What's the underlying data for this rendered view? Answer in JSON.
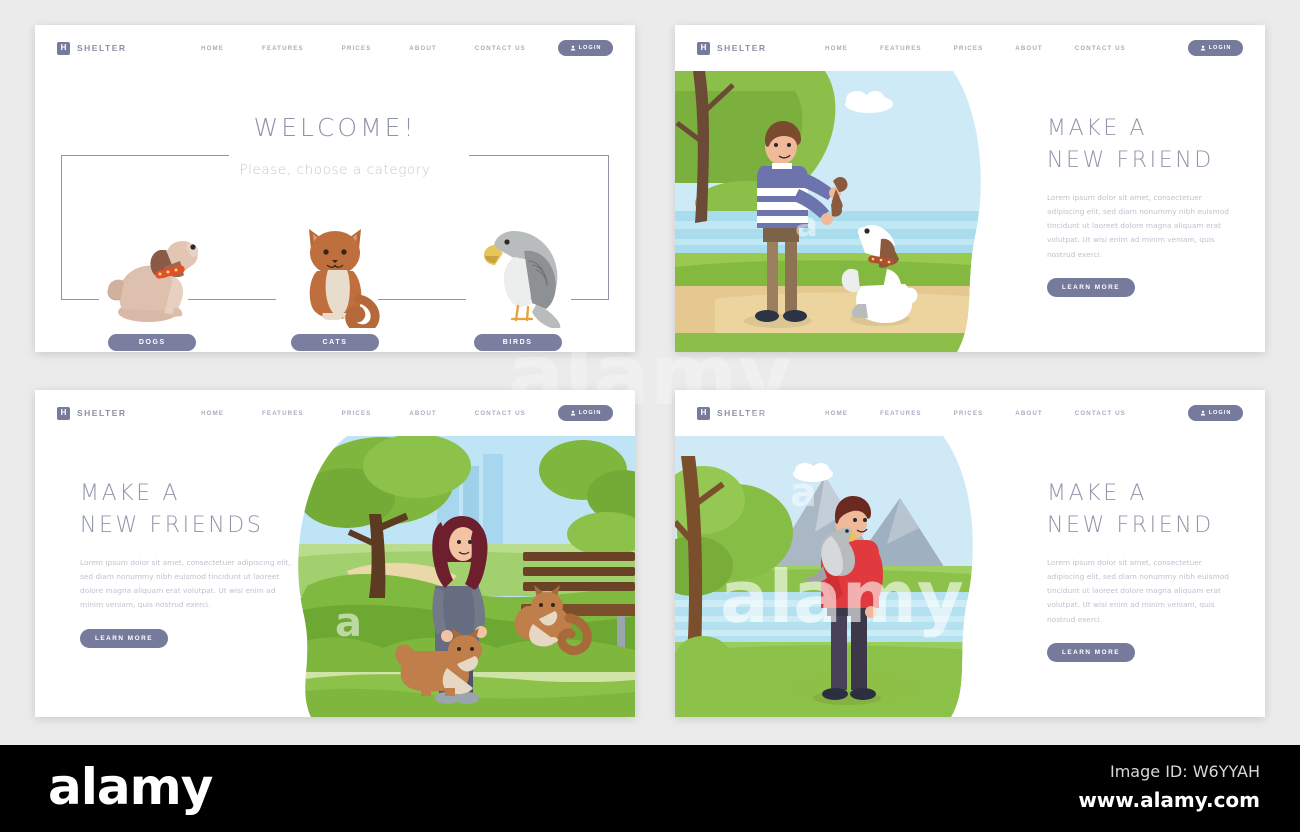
{
  "background": {
    "page": "#ebebeb",
    "card": "#ffffff",
    "accent": "#767b9c"
  },
  "nav": {
    "brand_glyph": "H",
    "brand_label": "SHELTER",
    "links": [
      "HOME",
      "FEATURES",
      "PRICES",
      "ABOUT",
      "CONTACT US"
    ],
    "login_label": "LOGIN",
    "login_icon": "person-icon"
  },
  "panels": {
    "welcome": {
      "title": "WELCOME!",
      "subtitle": "Please, choose a category",
      "categories": [
        {
          "label": "DOGS",
          "art": "dog-illustration"
        },
        {
          "label": "CATS",
          "art": "cat-illustration"
        },
        {
          "label": "BIRDS",
          "art": "bird-illustration"
        }
      ]
    },
    "dog_hero": {
      "heading": "MAKE A\nNEW FRIEND",
      "paragraph": "Lorem ipsum dolor sit amet, consectetuer adipiscing elit, sed diam nonummy nibh euismod tincidunt ut laoreet dolore magna aliquam erat volutpat. Ut wisi enim ad minim veniam, quis nostrud exerci.",
      "cta": "LEARN MORE",
      "art": "man-with-bone-and-dog-in-park"
    },
    "cat_hero": {
      "heading": "MAKE A\nNEW FRIENDS",
      "paragraph": "Lorem ipsum dolor sit amet, consectetuer adipiscing elit, sed diam nonummy nibh euismod tincidunt ut laoreet dolore magna aliquam erat volutpat. Ut wisi enim ad minim veniam, quis nostrud exerci.",
      "cta": "LEARN MORE",
      "art": "woman-with-two-cats-on-park-bench"
    },
    "bird_hero": {
      "heading": "MAKE A\nNEW FRIEND",
      "paragraph": "Lorem ipsum dolor sit amet, consectetuer adipiscing elit, sed diam nonummy nibh euismod tincidunt ut laoreet dolore magna aliquam erat volutpat. Ut wisi enim ad minim veniam, quis nostrud exerci.",
      "cta": "LEARN MORE",
      "art": "man-with-parrot-by-mountain-lake"
    }
  },
  "watermark": {
    "logo": "alamy",
    "image_id": "Image ID: W6YYAH",
    "url": "www.alamy.com",
    "ghost": "alamy",
    "ghost_short": "a"
  }
}
